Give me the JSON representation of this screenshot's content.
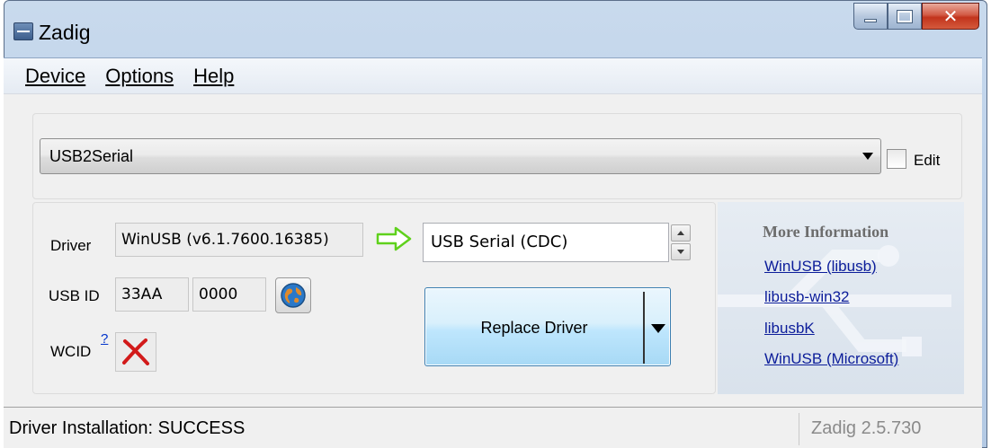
{
  "window": {
    "title": "Zadig"
  },
  "menu": {
    "device": "Device",
    "options": "Options",
    "help": "Help"
  },
  "device_select": {
    "value": "USB2Serial",
    "edit_label": "Edit"
  },
  "driver": {
    "label": "Driver",
    "current": "WinUSB (v6.1.7600.16385)",
    "target": "USB Serial (CDC)"
  },
  "usb_id": {
    "label": "USB ID",
    "vid": "33AA",
    "pid": "0000"
  },
  "wcid": {
    "label": "WCID",
    "help_mark": "?"
  },
  "replace_button": {
    "label": "Replace Driver"
  },
  "more_info": {
    "title": "More Information",
    "links": [
      "WinUSB (libusb)",
      "libusb-win32",
      "libusbK",
      "WinUSB (Microsoft)"
    ]
  },
  "status": {
    "text": "Driver Installation: SUCCESS",
    "version": "Zadig 2.5.730"
  },
  "colors": {
    "link": "#0c1d9a",
    "close_button": "#c2341c",
    "arrow": "#5fd11c"
  },
  "icons": [
    "app-icon",
    "minimize-icon",
    "maximize-icon",
    "close-icon",
    "dropdown-arrow-icon",
    "arrow-right-icon",
    "globe-icon",
    "x-icon",
    "spin-up-icon",
    "spin-down-icon",
    "split-arrow-icon"
  ]
}
